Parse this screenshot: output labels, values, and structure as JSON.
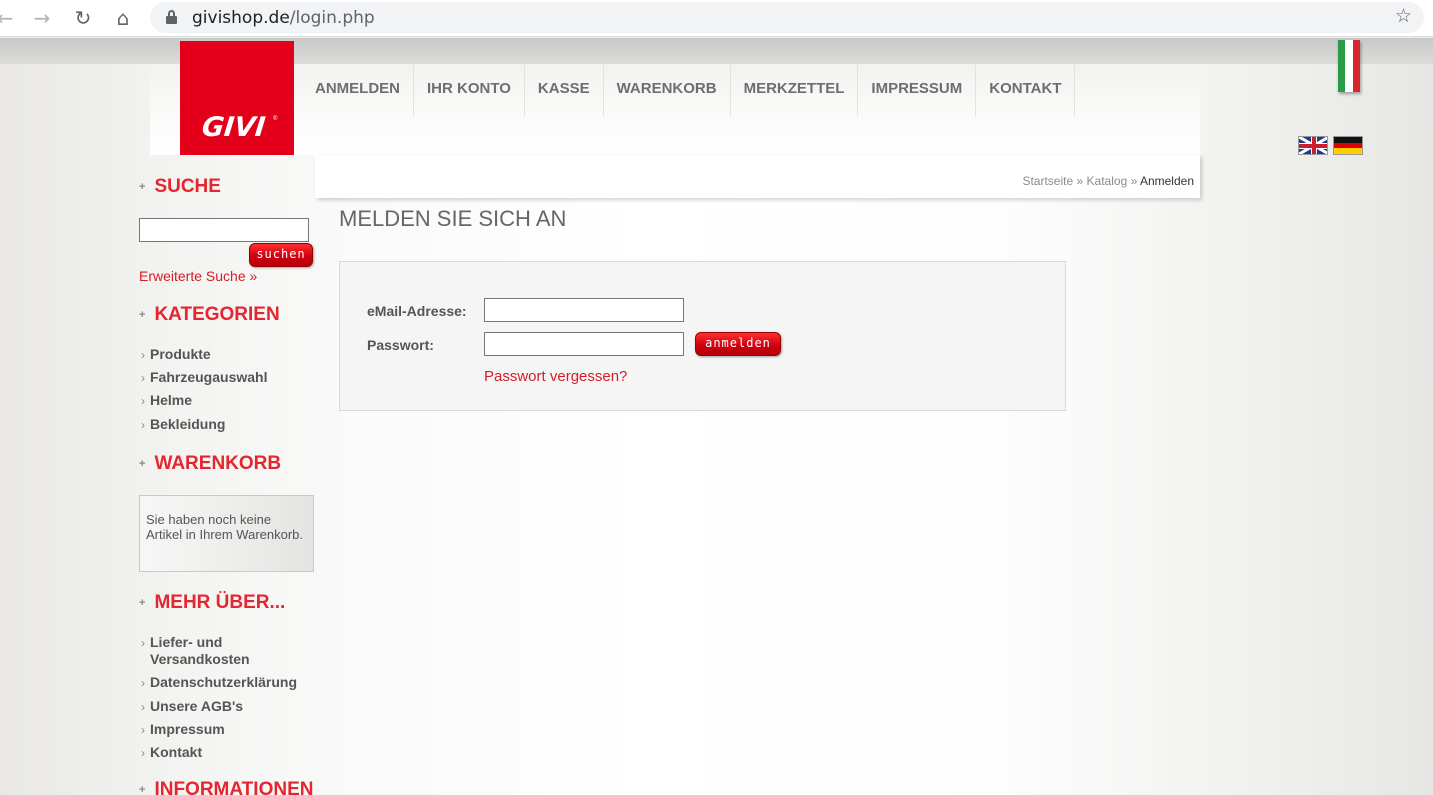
{
  "browser": {
    "back_icon": "←",
    "forward_icon": "→",
    "reload_icon": "↻",
    "home_icon": "⌂",
    "url_host": "givishop.de",
    "url_path": "/login.php",
    "star_icon": "☆"
  },
  "header": {
    "logo_text": "GIVI",
    "logo_reg": "®",
    "menu": [
      {
        "label": "ANMELDEN"
      },
      {
        "label": "IHR KONTO"
      },
      {
        "label": "KASSE"
      },
      {
        "label": "WARENKORB"
      },
      {
        "label": "MERKZETTEL"
      },
      {
        "label": "IMPRESSUM"
      },
      {
        "label": "KONTAKT"
      }
    ],
    "brand_red": "#e4001b"
  },
  "breadcrumb": {
    "items": [
      "Startseite",
      "Katalog",
      "Anmelden"
    ],
    "separator": "»"
  },
  "sidebar": {
    "plus_glyph": "+",
    "arrow_glyph": "›",
    "search": {
      "title": "SUCHE",
      "input_value": "",
      "button_label": "suchen",
      "advanced_link": "Erweiterte Suche »"
    },
    "categories": {
      "title": "KATEGORIEN",
      "items": [
        "Produkte",
        "Fahrzeugauswahl",
        "Helme",
        "Bekleidung"
      ]
    },
    "cart": {
      "title": "WARENKORB",
      "empty_text": "Sie haben noch keine Artikel in Ihrem Warenkorb."
    },
    "more": {
      "title": "MEHR ÜBER...",
      "items": [
        "Liefer- und Versandkosten",
        "Datenschutzerklärung",
        "Unsere AGB's",
        "Impressum",
        "Kontakt"
      ]
    },
    "info": {
      "title": "INFORMATIONEN"
    }
  },
  "main": {
    "title": "MELDEN SIE SICH AN",
    "email_label": "eMail-Adresse:",
    "email_value": "",
    "password_label": "Passwort:",
    "password_value": "",
    "login_button": "anmelden",
    "forgot_link": "Passwort vergessen?"
  }
}
